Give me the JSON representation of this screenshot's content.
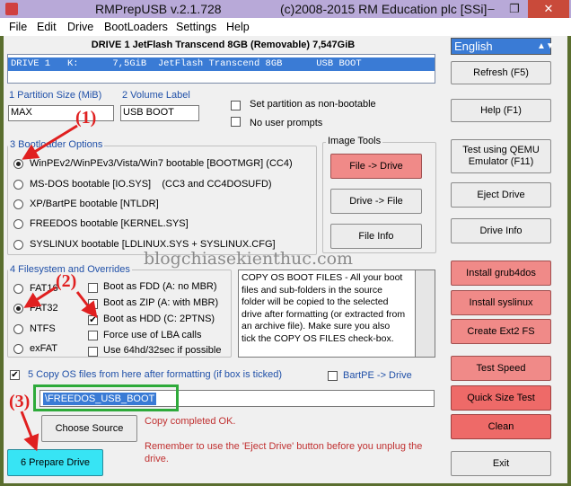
{
  "window": {
    "title": "RMPrepUSB v.2.1.728",
    "copyright": "(c)2008-2015 RM Education plc [SSi]",
    "controls": [
      "–",
      "❐",
      "✕"
    ]
  },
  "menu": [
    "File",
    "Edit",
    "Drive",
    "BootLoaders",
    "Settings",
    "Help"
  ],
  "drive_header": "DRIVE 1  JetFlash Transcend 8GB  (Removable) 7,547GiB",
  "drive_row": "DRIVE 1   K:      7,5GiB  JetFlash Transcend 8GB      USB BOOT",
  "language": "English",
  "partition": {
    "size_label": "1 Partition Size (MiB)",
    "size_value": "MAX",
    "volume_label": "2 Volume Label",
    "volume_value": "USB BOOT",
    "non_bootable": "Set partition as non-bootable",
    "no_prompts": "No user prompts"
  },
  "bootloader": {
    "legend": "3 Bootloader Options",
    "options": [
      "WinPEv2/WinPEv3/Vista/Win7 bootable [BOOTMGR] (CC4)",
      "MS-DOS bootable [IO.SYS]    (CC3 and CC4DOSUFD)",
      "XP/BartPE bootable [NTLDR]",
      "FREEDOS bootable [KERNEL.SYS]",
      "SYSLINUX bootable [LDLINUX.SYS + SYSLINUX.CFG]"
    ],
    "selected": 0
  },
  "image_tools": {
    "legend": "Image Tools",
    "file_to_drive": "File -> Drive",
    "drive_to_file": "Drive -> File",
    "file_info": "File Info"
  },
  "filesystem": {
    "legend": "4 Filesystem and Overrides",
    "options": [
      "FAT16",
      "FAT32",
      "NTFS",
      "exFAT"
    ],
    "selected": 1,
    "overrides": [
      {
        "label": "Boot as FDD (A: no MBR)",
        "checked": false
      },
      {
        "label": "Boot as ZIP (A: with MBR)",
        "checked": false
      },
      {
        "label": "Boot as HDD (C: 2PTNS)",
        "checked": true
      },
      {
        "label": "Force use of LBA calls",
        "checked": false
      },
      {
        "label": "Use 64hd/32sec if possible",
        "checked": false
      }
    ]
  },
  "info_text": "COPY OS BOOT FILES - All your boot files and sub-folders in the source folder will be copied to the selected drive after formatting (or extracted from an archive file). Make sure you also tick the COPY OS FILES check-box.",
  "copy_os": {
    "label": "5 Copy OS files from here after formatting (if box is ticked)",
    "checked": true
  },
  "bartpe": {
    "label": "BartPE -> Drive",
    "checked": false
  },
  "source_path": "\\FREEDOS_USB_BOOT",
  "choose_source": "Choose Source",
  "status_lines": [
    "Copy completed OK.",
    "Remember to use the 'Eject Drive' button before you unplug the",
    "drive."
  ],
  "prepare_drive": "6 Prepare Drive",
  "right_buttons": {
    "refresh": "Refresh (F5)",
    "help": "Help (F1)",
    "qemu": "Test using QEMU Emulator (F11)",
    "eject": "Eject Drive",
    "drive_info": "Drive Info",
    "grub4dos": "Install grub4dos",
    "syslinux": "Install syslinux",
    "ext2": "Create Ext2 FS",
    "test_speed": "Test Speed",
    "quick_size": "Quick Size Test",
    "clean": "Clean",
    "exit": "Exit"
  },
  "annotations": [
    "(1)",
    "(2)",
    "(3)"
  ],
  "watermark": "blogchiasekienthuc.com",
  "colors": {
    "selection": "#3a7bd5",
    "pink_button": "#f08a88",
    "red_button": "#ee6a68",
    "prepare_button": "#37e4f4",
    "annotation": "#e02020",
    "highlight_box": "#2eaa3a"
  }
}
